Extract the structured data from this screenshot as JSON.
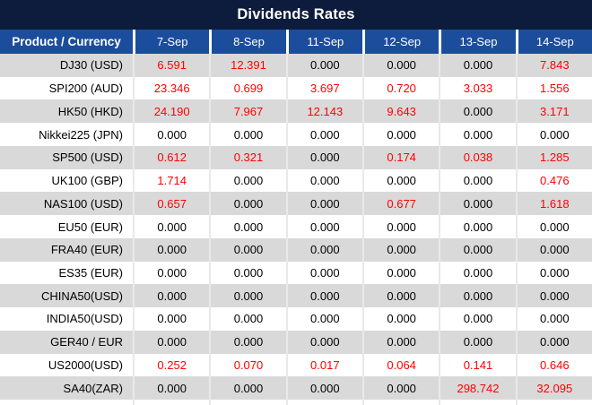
{
  "title": "Dividends Rates",
  "table": {
    "header": [
      "Product / Currency",
      "7-Sep",
      "8-Sep",
      "11-Sep",
      "12-Sep",
      "13-Sep",
      "14-Sep"
    ],
    "rows": [
      {
        "product": "DJ30 (USD)",
        "values": [
          "6.591",
          "12.391",
          "0.000",
          "0.000",
          "0.000",
          "7.843"
        ]
      },
      {
        "product": "SPI200 (AUD)",
        "values": [
          "23.346",
          "0.699",
          "3.697",
          "0.720",
          "3.033",
          "1.556"
        ]
      },
      {
        "product": "HK50 (HKD)",
        "values": [
          "24.190",
          "7.967",
          "12.143",
          "9.643",
          "0.000",
          "3.171"
        ]
      },
      {
        "product": "Nikkei225 (JPN)",
        "values": [
          "0.000",
          "0.000",
          "0.000",
          "0.000",
          "0.000",
          "0.000"
        ]
      },
      {
        "product": "SP500 (USD)",
        "values": [
          "0.612",
          "0.321",
          "0.000",
          "0.174",
          "0.038",
          "1.285"
        ]
      },
      {
        "product": "UK100 (GBP)",
        "values": [
          "1.714",
          "0.000",
          "0.000",
          "0.000",
          "0.000",
          "0.476"
        ]
      },
      {
        "product": "NAS100 (USD)",
        "values": [
          "0.657",
          "0.000",
          "0.000",
          "0.677",
          "0.000",
          "1.618"
        ]
      },
      {
        "product": "EU50 (EUR)",
        "values": [
          "0.000",
          "0.000",
          "0.000",
          "0.000",
          "0.000",
          "0.000"
        ]
      },
      {
        "product": "FRA40 (EUR)",
        "values": [
          "0.000",
          "0.000",
          "0.000",
          "0.000",
          "0.000",
          "0.000"
        ]
      },
      {
        "product": "ES35 (EUR)",
        "values": [
          "0.000",
          "0.000",
          "0.000",
          "0.000",
          "0.000",
          "0.000"
        ]
      },
      {
        "product": "CHINA50(USD)",
        "values": [
          "0.000",
          "0.000",
          "0.000",
          "0.000",
          "0.000",
          "0.000"
        ]
      },
      {
        "product": "INDIA50(USD)",
        "values": [
          "0.000",
          "0.000",
          "0.000",
          "0.000",
          "0.000",
          "0.000"
        ]
      },
      {
        "product": "GER40 / EUR",
        "values": [
          "0.000",
          "0.000",
          "0.000",
          "0.000",
          "0.000",
          "0.000"
        ]
      },
      {
        "product": "US2000(USD)",
        "values": [
          "0.252",
          "0.070",
          "0.017",
          "0.064",
          "0.141",
          "0.646"
        ]
      },
      {
        "product": "SA40(ZAR)",
        "values": [
          "0.000",
          "0.000",
          "0.000",
          "0.000",
          "298.742",
          "32.095"
        ]
      }
    ]
  },
  "colors": {
    "title_bar_bg": "#0d1c3c",
    "header_bg": "#1b4d9c",
    "header_text": "#ffffff",
    "stripe_gray": "#d9d9d9",
    "stripe_white": "#ffffff",
    "value_zero": "#000000",
    "value_nonzero": "#ff0000",
    "body_separator": "#e9e9e9"
  }
}
